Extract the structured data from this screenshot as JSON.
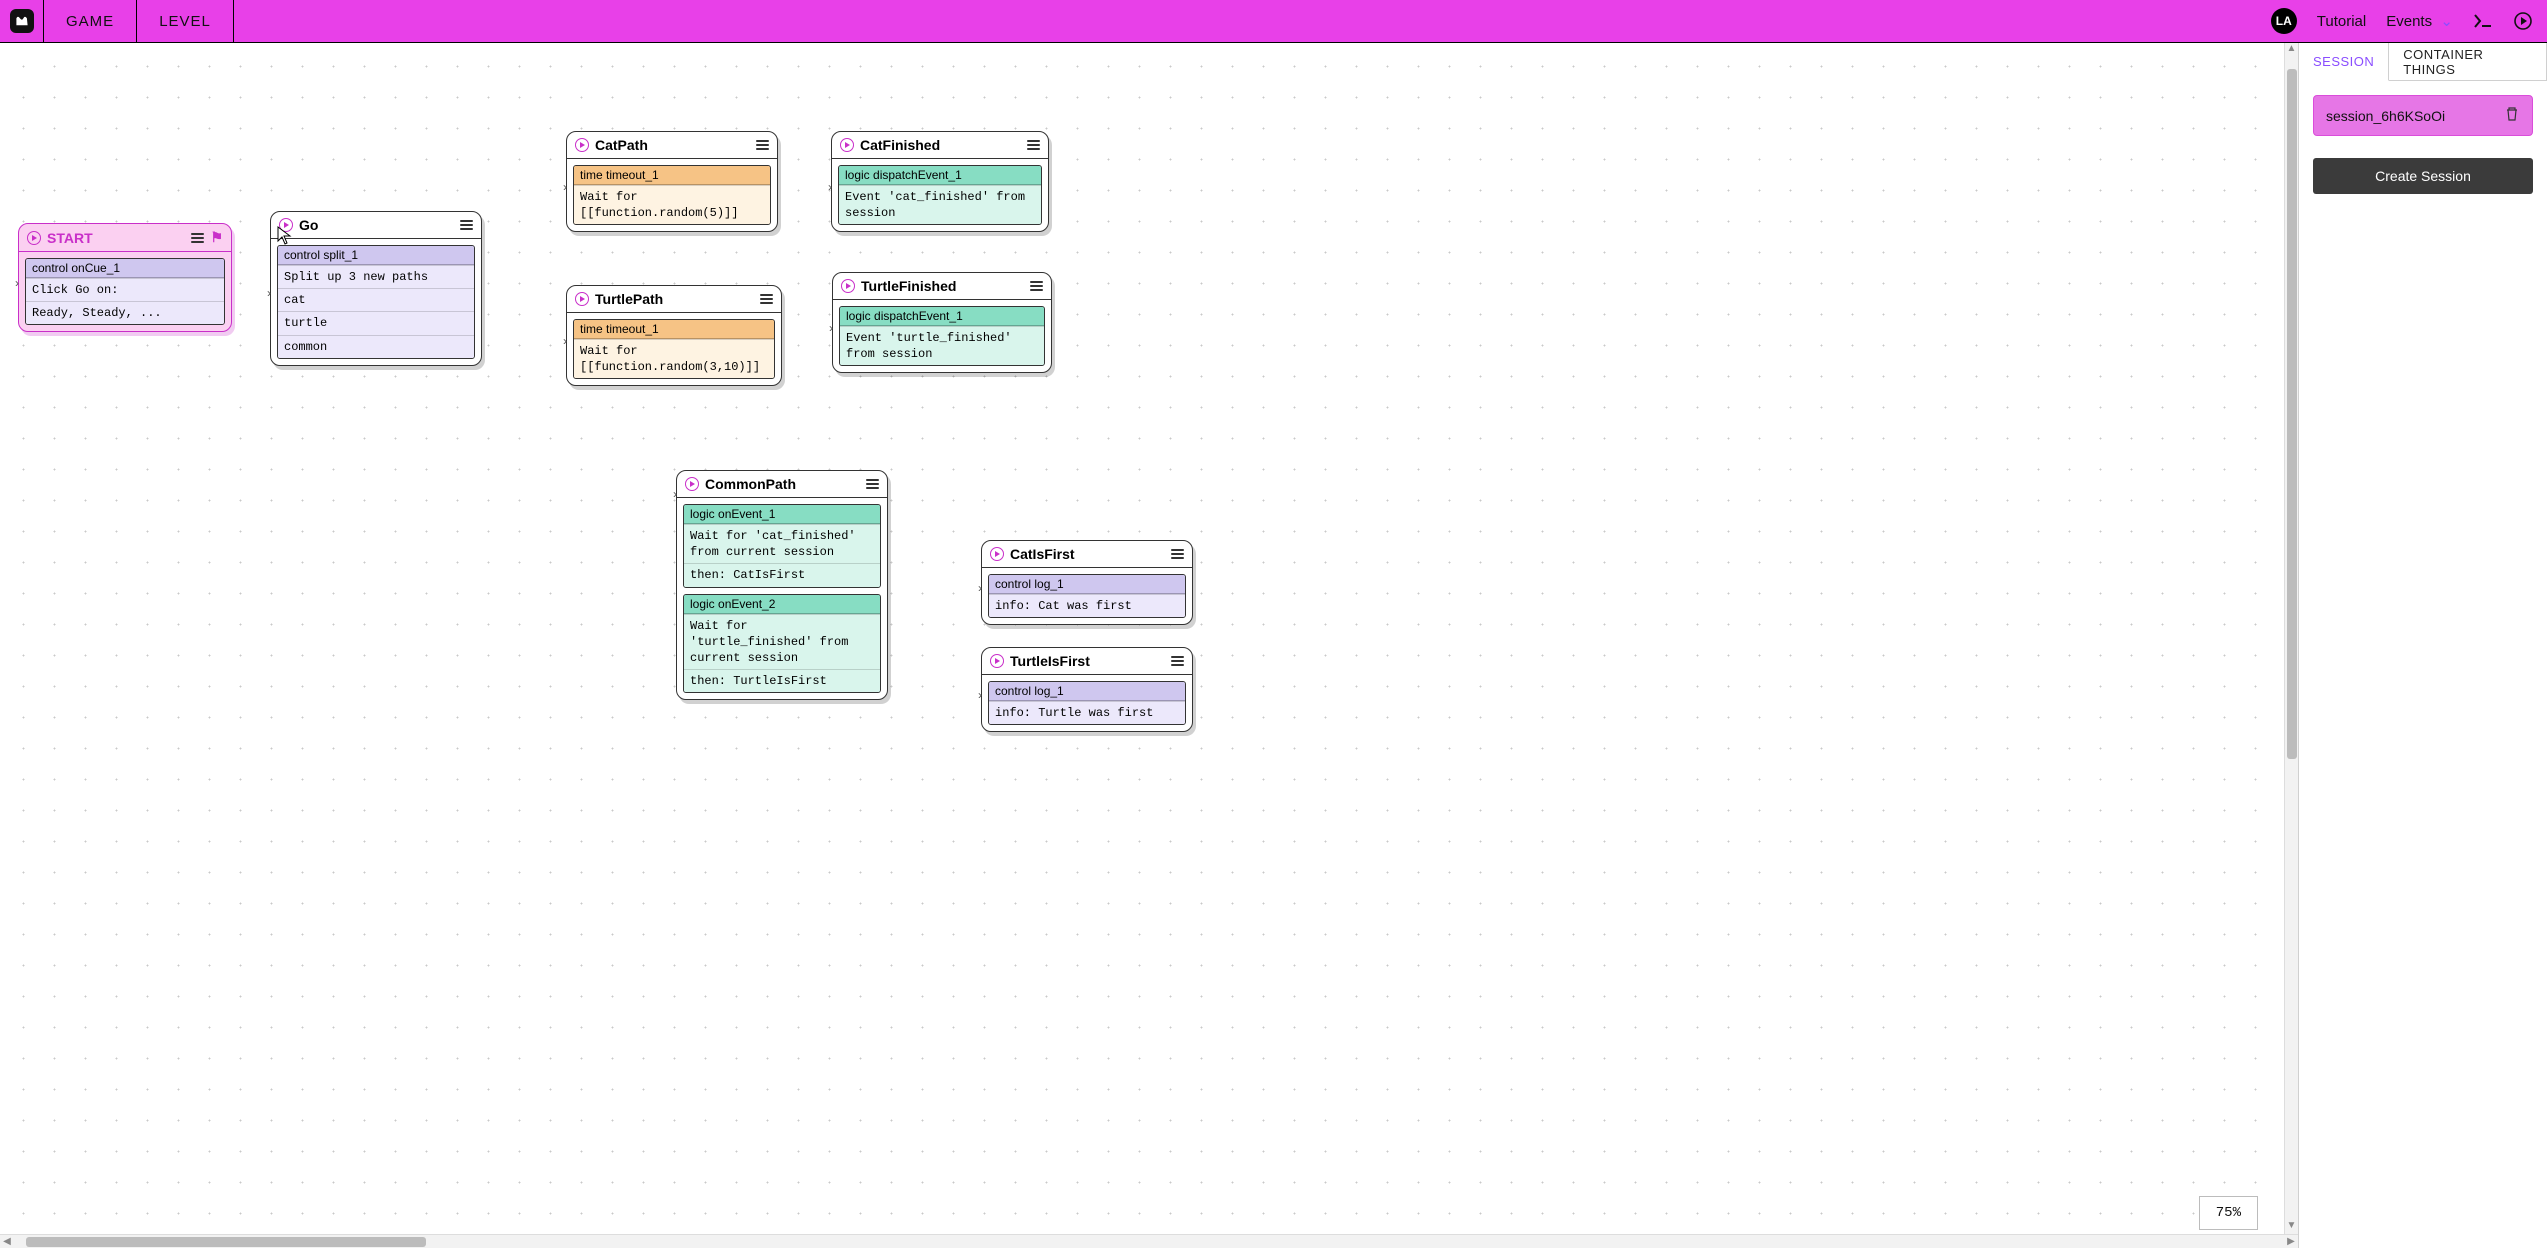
{
  "topbar": {
    "nav": {
      "game": "GAME",
      "level": "LEVEL"
    },
    "avatar": "LA",
    "tutorial": "Tutorial",
    "events": "Events"
  },
  "right_panel": {
    "tabs": {
      "session": "SESSION",
      "container": "CONTAINER THINGS"
    },
    "session_name": "session_6h6KSoOi",
    "create_btn": "Create Session"
  },
  "zoom": "75%",
  "nodes": {
    "start": {
      "title": "START",
      "section": {
        "head": "control onCue_1",
        "rows": [
          "Click Go on:",
          "Ready, Steady, ..."
        ]
      }
    },
    "go": {
      "title": "Go",
      "section": {
        "head": "control split_1",
        "rows": [
          "Split up 3 new paths",
          "cat",
          "turtle",
          "common"
        ]
      }
    },
    "catpath": {
      "title": "CatPath",
      "section": {
        "head": "time timeout_1",
        "rows": [
          "Wait for [[function.random(5)]]"
        ]
      }
    },
    "turtlepath": {
      "title": "TurtlePath",
      "section": {
        "head": "time timeout_1",
        "rows": [
          "Wait for [[function.random(3,10)]]"
        ]
      }
    },
    "catfinished": {
      "title": "CatFinished",
      "section": {
        "head": "logic dispatchEvent_1",
        "rows": [
          "Event 'cat_finished' from session"
        ]
      }
    },
    "turtlefinished": {
      "title": "TurtleFinished",
      "section": {
        "head": "logic dispatchEvent_1",
        "rows": [
          "Event 'turtle_finished' from session"
        ]
      }
    },
    "commonpath": {
      "title": "CommonPath",
      "section1": {
        "head": "logic onEvent_1",
        "rows": [
          "Wait for 'cat_finished' from current session",
          "then: CatIsFirst"
        ]
      },
      "section2": {
        "head": "logic onEvent_2",
        "rows": [
          "Wait for 'turtle_finished' from current session",
          "then: TurtleIsFirst"
        ]
      }
    },
    "catisfirst": {
      "title": "CatIsFirst",
      "section": {
        "head": "control log_1",
        "rows": [
          "info: Cat was first"
        ]
      }
    },
    "turtleisfirst": {
      "title": "TurtleIsFirst",
      "section": {
        "head": "control log_1",
        "rows": [
          "info: Turtle was first"
        ]
      }
    }
  }
}
